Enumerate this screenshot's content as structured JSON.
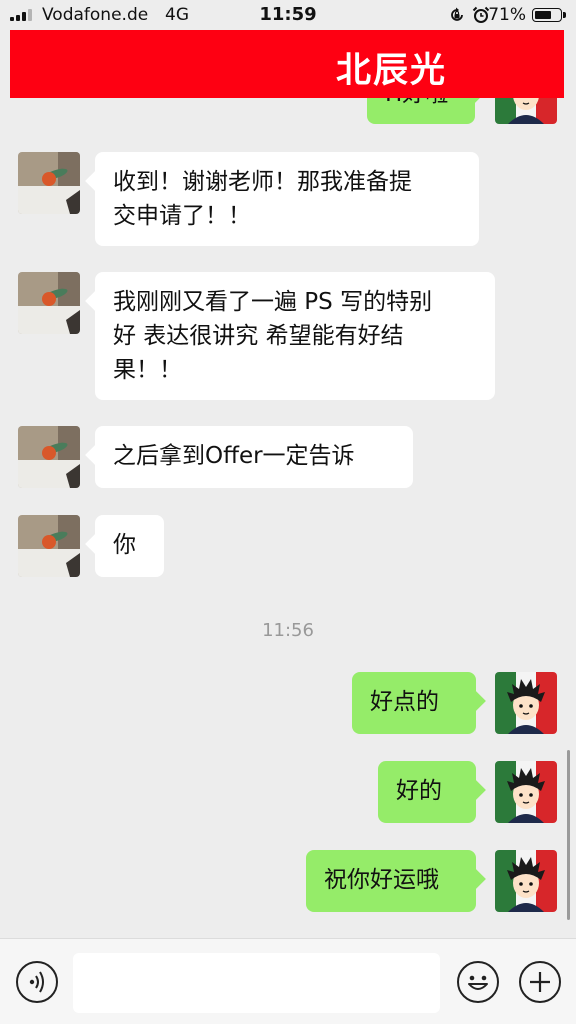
{
  "status_bar": {
    "carrier": "Vodafone.de",
    "network": "4G",
    "time": "11:59",
    "battery_percent": "71%",
    "battery_level": 0.71,
    "icons": [
      "signal-icon",
      "orientation-lock-icon",
      "alarm-icon",
      "battery-icon"
    ]
  },
  "banner": {
    "text": "北辰光",
    "color": "#fe0012"
  },
  "chat": {
    "partial_top_message": "H好啦",
    "messages_in": [
      {
        "lines": [
          "收到！谢谢老师！那我准备提",
          "交申请了！！"
        ]
      },
      {
        "lines": [
          "我刚刚又看了一遍 PS 写的特别",
          "好 表达很讲究 希望能有好结",
          "果！！"
        ]
      },
      {
        "lines": [
          "之后拿到Offer一定告诉"
        ]
      },
      {
        "lines": [
          "你"
        ]
      }
    ],
    "timestamp": "11:56",
    "messages_out": [
      {
        "text": "好点的"
      },
      {
        "text": "好的"
      },
      {
        "text": "祝你好运哦"
      }
    ],
    "colors": {
      "incoming_bubble": "#ffffff",
      "outgoing_bubble": "#95ec69",
      "background": "#ededed"
    }
  },
  "input_bar": {
    "icons": [
      "voice-icon",
      "emoji-icon",
      "plus-icon"
    ],
    "message_value": ""
  }
}
